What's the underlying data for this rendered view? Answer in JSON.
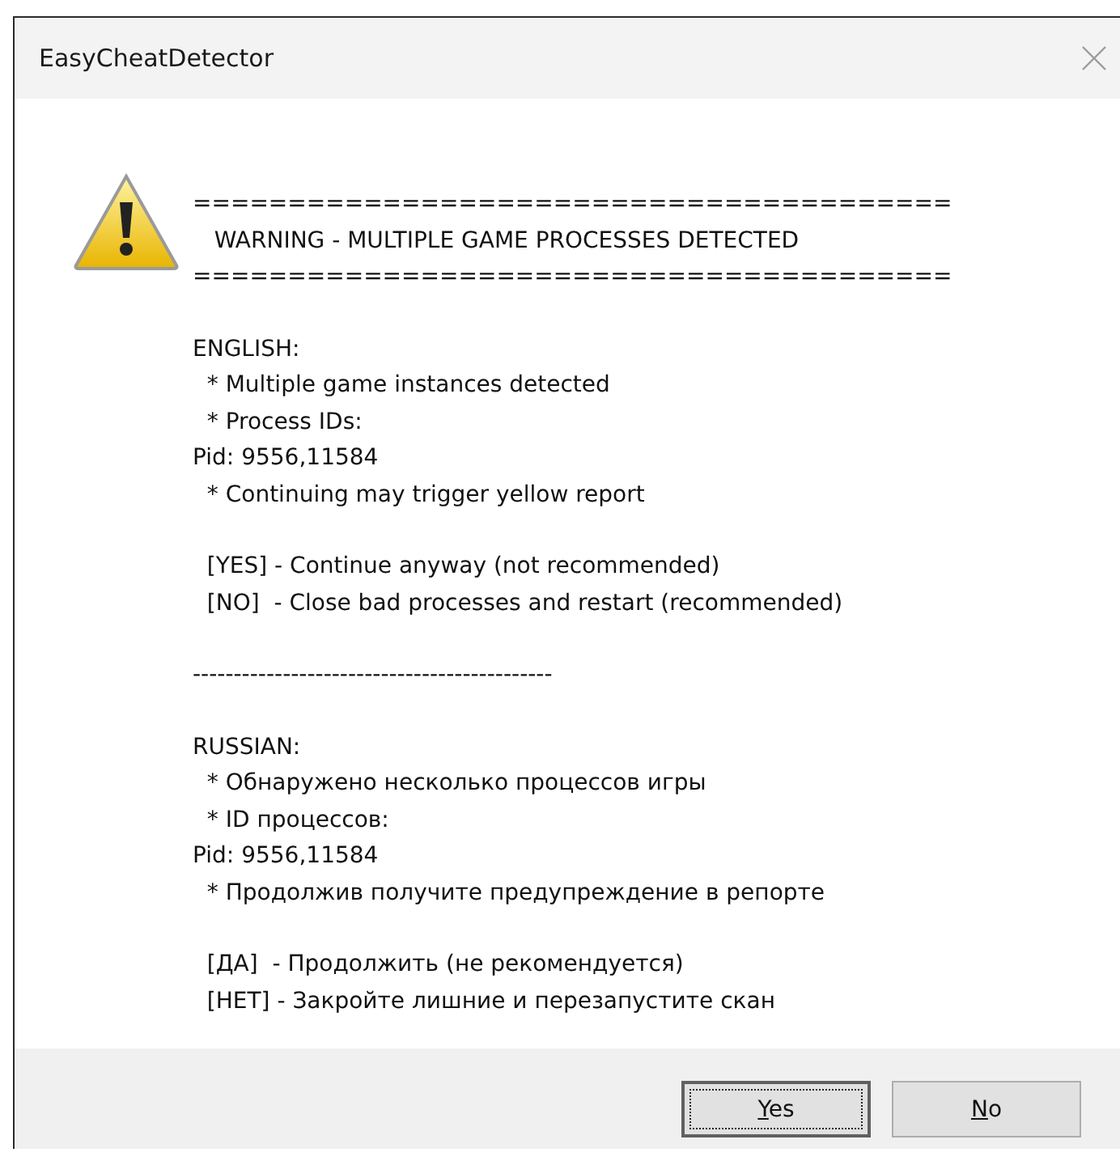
{
  "window": {
    "title": "EasyCheatDetector"
  },
  "message_blocks": [
    [
      "========================================",
      "   WARNING - MULTIPLE GAME PROCESSES DETECTED",
      "========================================"
    ],
    [
      "ENGLISH:",
      "  * Multiple game instances detected",
      "  * Process IDs:",
      "Pid: 9556,11584",
      "  * Continuing may trigger yellow report"
    ],
    [
      "  [YES] - Continue anyway (not recommended)",
      "  [NO]  - Close bad processes and restart (recommended)"
    ],
    [
      "--------------------------------------------"
    ],
    [
      "RUSSIAN:",
      "  * Обнаружено несколько процессов игры",
      "  * ID процессов:",
      "Pid: 9556,11584",
      "  * Продолжив получите предупреждение в репорте"
    ],
    [
      "  [ДА]  - Продолжить (не рекомендуется)",
      "  [НЕТ] - Закройте лишние и перезапустите скан"
    ]
  ],
  "buttons": [
    {
      "label": "Yes",
      "focused": true
    },
    {
      "label": "No",
      "focused": false
    }
  ]
}
